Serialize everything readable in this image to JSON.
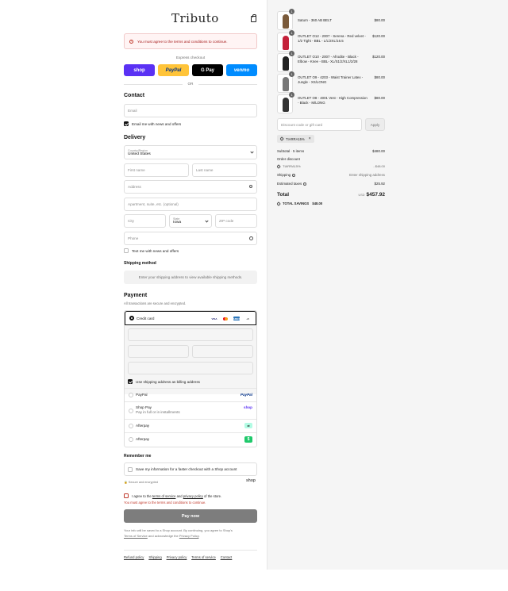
{
  "brand": {
    "logo_text": "Tributo"
  },
  "alert": {
    "text": "You must agree to the terms and conditions to continue."
  },
  "express": {
    "label": "Express checkout",
    "buttons": [
      {
        "label": "shop",
        "bg": "#5a31f4",
        "fg": "#ffffff"
      },
      {
        "label": "PayPal",
        "bg": "#ffc439",
        "fg": "#003087"
      },
      {
        "label": "G Pay",
        "bg": "#000000",
        "fg": "#ffffff"
      },
      {
        "label": "venmo",
        "bg": "#008cff",
        "fg": "#ffffff"
      }
    ],
    "or_label": "OR"
  },
  "contact": {
    "title": "Contact",
    "email_placeholder": "Email",
    "news_label": "Email me with news and offers"
  },
  "delivery": {
    "title": "Delivery",
    "country_label": "Country/Region",
    "country_value": "United States",
    "first_name": "First name",
    "last_name": "Last name",
    "address": "Address",
    "apartment": "Apartment, suite, etc. (optional)",
    "city": "City",
    "state_label": "State",
    "state_value": "Iowa",
    "zip": "ZIP code",
    "phone": "Phone",
    "text_offers": "Text me with news and offers"
  },
  "shipping": {
    "title": "Shipping method",
    "message": "Enter your shipping address to view available shipping methods."
  },
  "payment": {
    "title": "Payment",
    "subtitle": "All transactions are secure and encrypted.",
    "credit_card": "Credit card",
    "card_icons": [
      "VISA",
      "MC",
      "AMEX",
      "+5"
    ],
    "billing_same": "Use shipping address as billing address",
    "options": [
      {
        "label": "PayPal",
        "sub": "",
        "brand": "PayPal"
      },
      {
        "label": "Shop Pay",
        "sub": "Pay in full or in installments",
        "brand": "shop"
      },
      {
        "label": "Afterpay",
        "sub": "",
        "brand": "afterpay"
      },
      {
        "label": "Afterpay",
        "sub": "",
        "brand": "$"
      }
    ]
  },
  "remember": {
    "title": "Remember me",
    "save_label": "Save my information for a faster checkout with a Shop account",
    "secure": "Secure and encrypted",
    "shop": "shop"
  },
  "terms": {
    "prefix": "I agree to the ",
    "tos": "terms of service",
    "and": " and ",
    "privacy": "privacy policy",
    "suffix": " of the store.",
    "error": "You must agree to the terms and conditions to continue."
  },
  "pay_now": "Pay now",
  "disclaimer": {
    "line1": "Your info will be saved to a Shop account. By continuing, you agree to Shop's",
    "tos": "Terms of Service",
    "mid": " and acknowledge the ",
    "privacy": "Privacy Policy",
    "end": "."
  },
  "footer_links": [
    "Refund policy",
    "Shipping",
    "Privacy policy",
    "Terms of service",
    "Contact"
  ],
  "cart": {
    "items": [
      {
        "name": "Saturn - 360 AB BELT",
        "price": "$80.00",
        "qty": "1",
        "color": "#7a5a3a"
      },
      {
        "name": "OUTLET O12 - 2007 - Serena - Red velvet - 1/2 Tight - BBL - L/L/2XL/16.5",
        "price": "$120.00",
        "qty": "1",
        "color": "#c4213a"
      },
      {
        "name": "OUTLET O10 - 2007 - Afrodite - Black - Elbow - Knee - BBL- XL/S1/2/XL1/2/28",
        "price": "$120.00",
        "qty": "1",
        "color": "#222222"
      },
      {
        "name": "OUTLET O9 - 4203 - Waist Trainer Latex - Jungle - XS/LONG",
        "price": "$80.00",
        "qty": "1",
        "color": "#777777"
      },
      {
        "name": "OUTLET O8 - 4001 Vest - High Compression - Black - M/LONG",
        "price": "$80.00",
        "qty": "1",
        "color": "#333333"
      }
    ],
    "discount_placeholder": "Discount code or gift card",
    "apply": "Apply",
    "code_tag": "TIARRA15%",
    "subtotal_label": "Subtotal · 5 items",
    "subtotal": "$480.00",
    "order_discount": "Order discount",
    "discount_code": "TIARRA15%",
    "discount_value": "- $48.00",
    "shipping_label": "Shipping",
    "shipping_value": "Enter shipping address",
    "taxes_label": "Estimated taxes",
    "taxes_value": "$25.92",
    "total_label": "Total",
    "currency": "USD",
    "total_value": "$457.92",
    "savings_label": "TOTAL SAVINGS",
    "savings_value": "$48.00"
  }
}
